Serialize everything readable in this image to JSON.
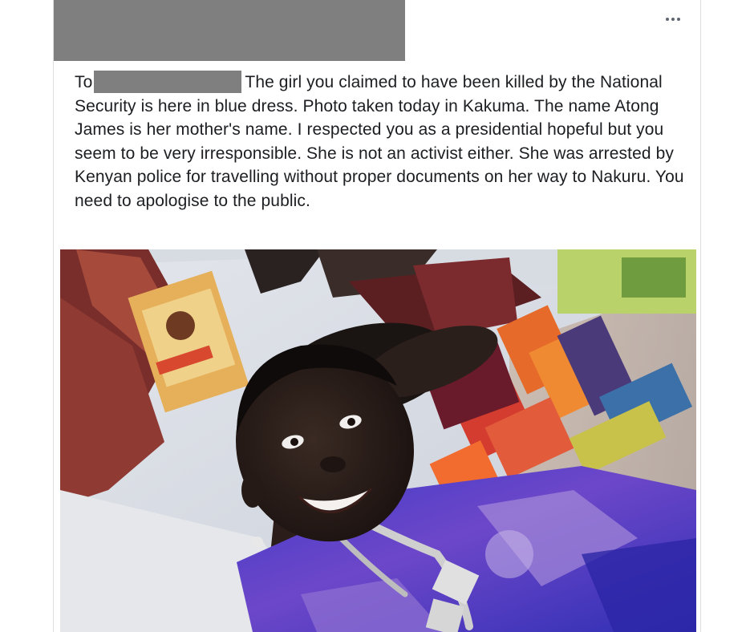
{
  "post": {
    "header_redacted": "",
    "more_options_icon": "more-horizontal-icon",
    "text_to": "To",
    "text_body": "The girl you claimed to have been killed by the National Security is here in blue dress. Photo taken today in Kakuma. The name Atong James is her mother's name. I respected you as a presidential hopeful but you seem to be very irresponsible. She is not an activist either. She was arrested by Kenyan police for travelling without proper documents on her way to Nakuru. You need to apologise to the public.",
    "photo_icon": "photo-image"
  },
  "colors": {
    "redaction": "#7f7f7f",
    "text": "#1c1e21",
    "card_border": "#dddfe2",
    "icon": "#606770"
  }
}
